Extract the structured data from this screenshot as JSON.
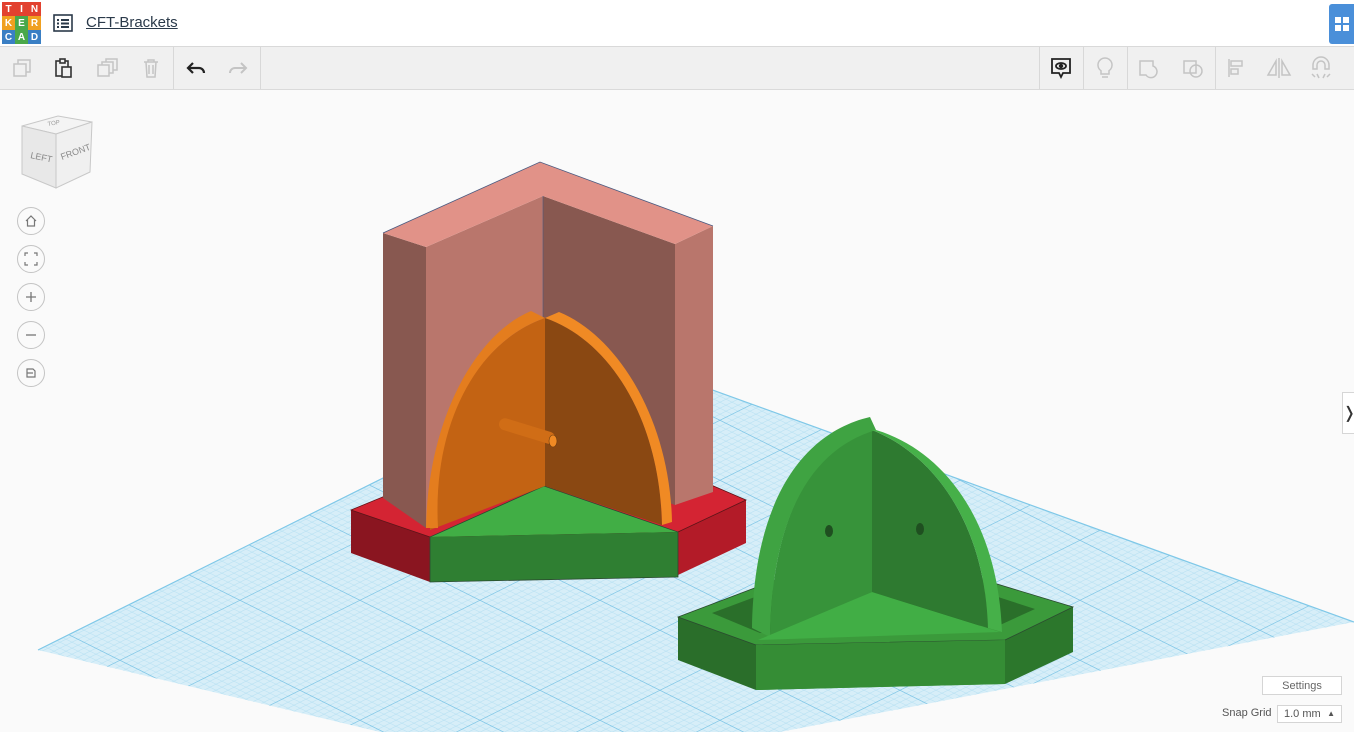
{
  "app": {
    "logo_letters": [
      "T",
      "I",
      "N",
      "K",
      "E",
      "R",
      "C",
      "A",
      "D"
    ],
    "logo_colors": [
      "#e2412f",
      "#e2412f",
      "#e2412f",
      "#f0a020",
      "#4aa84a",
      "#f0a020",
      "#3a7fc4",
      "#4aa84a",
      "#3a7fc4"
    ]
  },
  "header": {
    "project_title": "CFT-Brackets"
  },
  "toolbar": {
    "left_tools": [
      "copy-icon",
      "paste-icon",
      "duplicate-icon",
      "delete-icon",
      "undo-icon",
      "redo-icon"
    ],
    "right_tools": [
      "notes-visibility-icon",
      "lightbulb-icon",
      "group-icon",
      "ungroup-icon",
      "align-icon",
      "mirror-icon",
      "magnet-icon"
    ]
  },
  "view_cube": {
    "left_label": "LEFT",
    "front_label": "FRONT",
    "top_label": "TOP"
  },
  "nav": [
    "home-view-icon",
    "fit-all-icon",
    "zoom-in-icon",
    "zoom-out-icon",
    "projection-icon"
  ],
  "footer": {
    "settings_label": "Settings",
    "snap_grid_label": "Snap Grid",
    "snap_grid_value": "1.0 mm"
  },
  "colors": {
    "workplane_grid": "#7fc8e8",
    "workplane_fill": "#d7eef8",
    "pink_wall": "#b9766c",
    "orange_bracket": "#e07a1c",
    "green_bracket": "#3b9a3b",
    "red_base": "#d42433",
    "accent_blue": "#4a8fd9"
  }
}
